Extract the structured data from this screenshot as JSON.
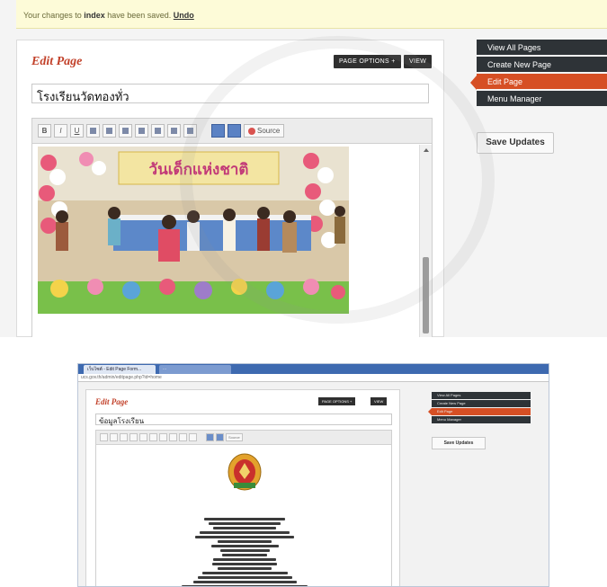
{
  "screenshot_top": {
    "notice": {
      "prefix": "Your changes to ",
      "page": "index",
      "suffix": " have been saved. ",
      "undo": "Undo"
    },
    "header": {
      "title": "Edit Page",
      "page_options": "PAGE OPTIONS +",
      "view": "VIEW"
    },
    "title_field": {
      "value": "โรงเรียนวัดทองทั่ว"
    },
    "toolbar": {
      "bold": "B",
      "italic": "I",
      "underline": "U",
      "source": "Source"
    },
    "image": {
      "banner_text": "วันเด็กแห่งชาติ",
      "description": "children dancing on stage with balloon decorations"
    },
    "sidebar": {
      "items": [
        {
          "label": "View All Pages"
        },
        {
          "label": "Create New Page"
        },
        {
          "label": "Edit Page"
        },
        {
          "label": "Menu Manager"
        }
      ],
      "save_label": "Save Updates"
    },
    "colors": {
      "accent": "#d64f24",
      "nav_dark": "#2e3337",
      "title_red": "#c2412a"
    }
  },
  "screenshot_bottom": {
    "tabs": [
      {
        "label": "เว็บไซต์ - Edit Page Form..."
      },
      {
        "label": "..."
      }
    ],
    "url": "ucs.gov.th/admin/editpage.php?id=home",
    "header": {
      "title": "Edit Page",
      "page_options": "PAGE OPTIONS +",
      "view": "VIEW"
    },
    "title_field": {
      "value": "ข้อมูลโรงเรียน"
    },
    "toolbar": {
      "source": "Source"
    },
    "sidebar": {
      "items": [
        {
          "label": "View All Pages"
        },
        {
          "label": "Create New Page"
        },
        {
          "label": "Edit Page"
        },
        {
          "label": "Menu Manager"
        }
      ],
      "save_label": "Save Updates"
    }
  }
}
